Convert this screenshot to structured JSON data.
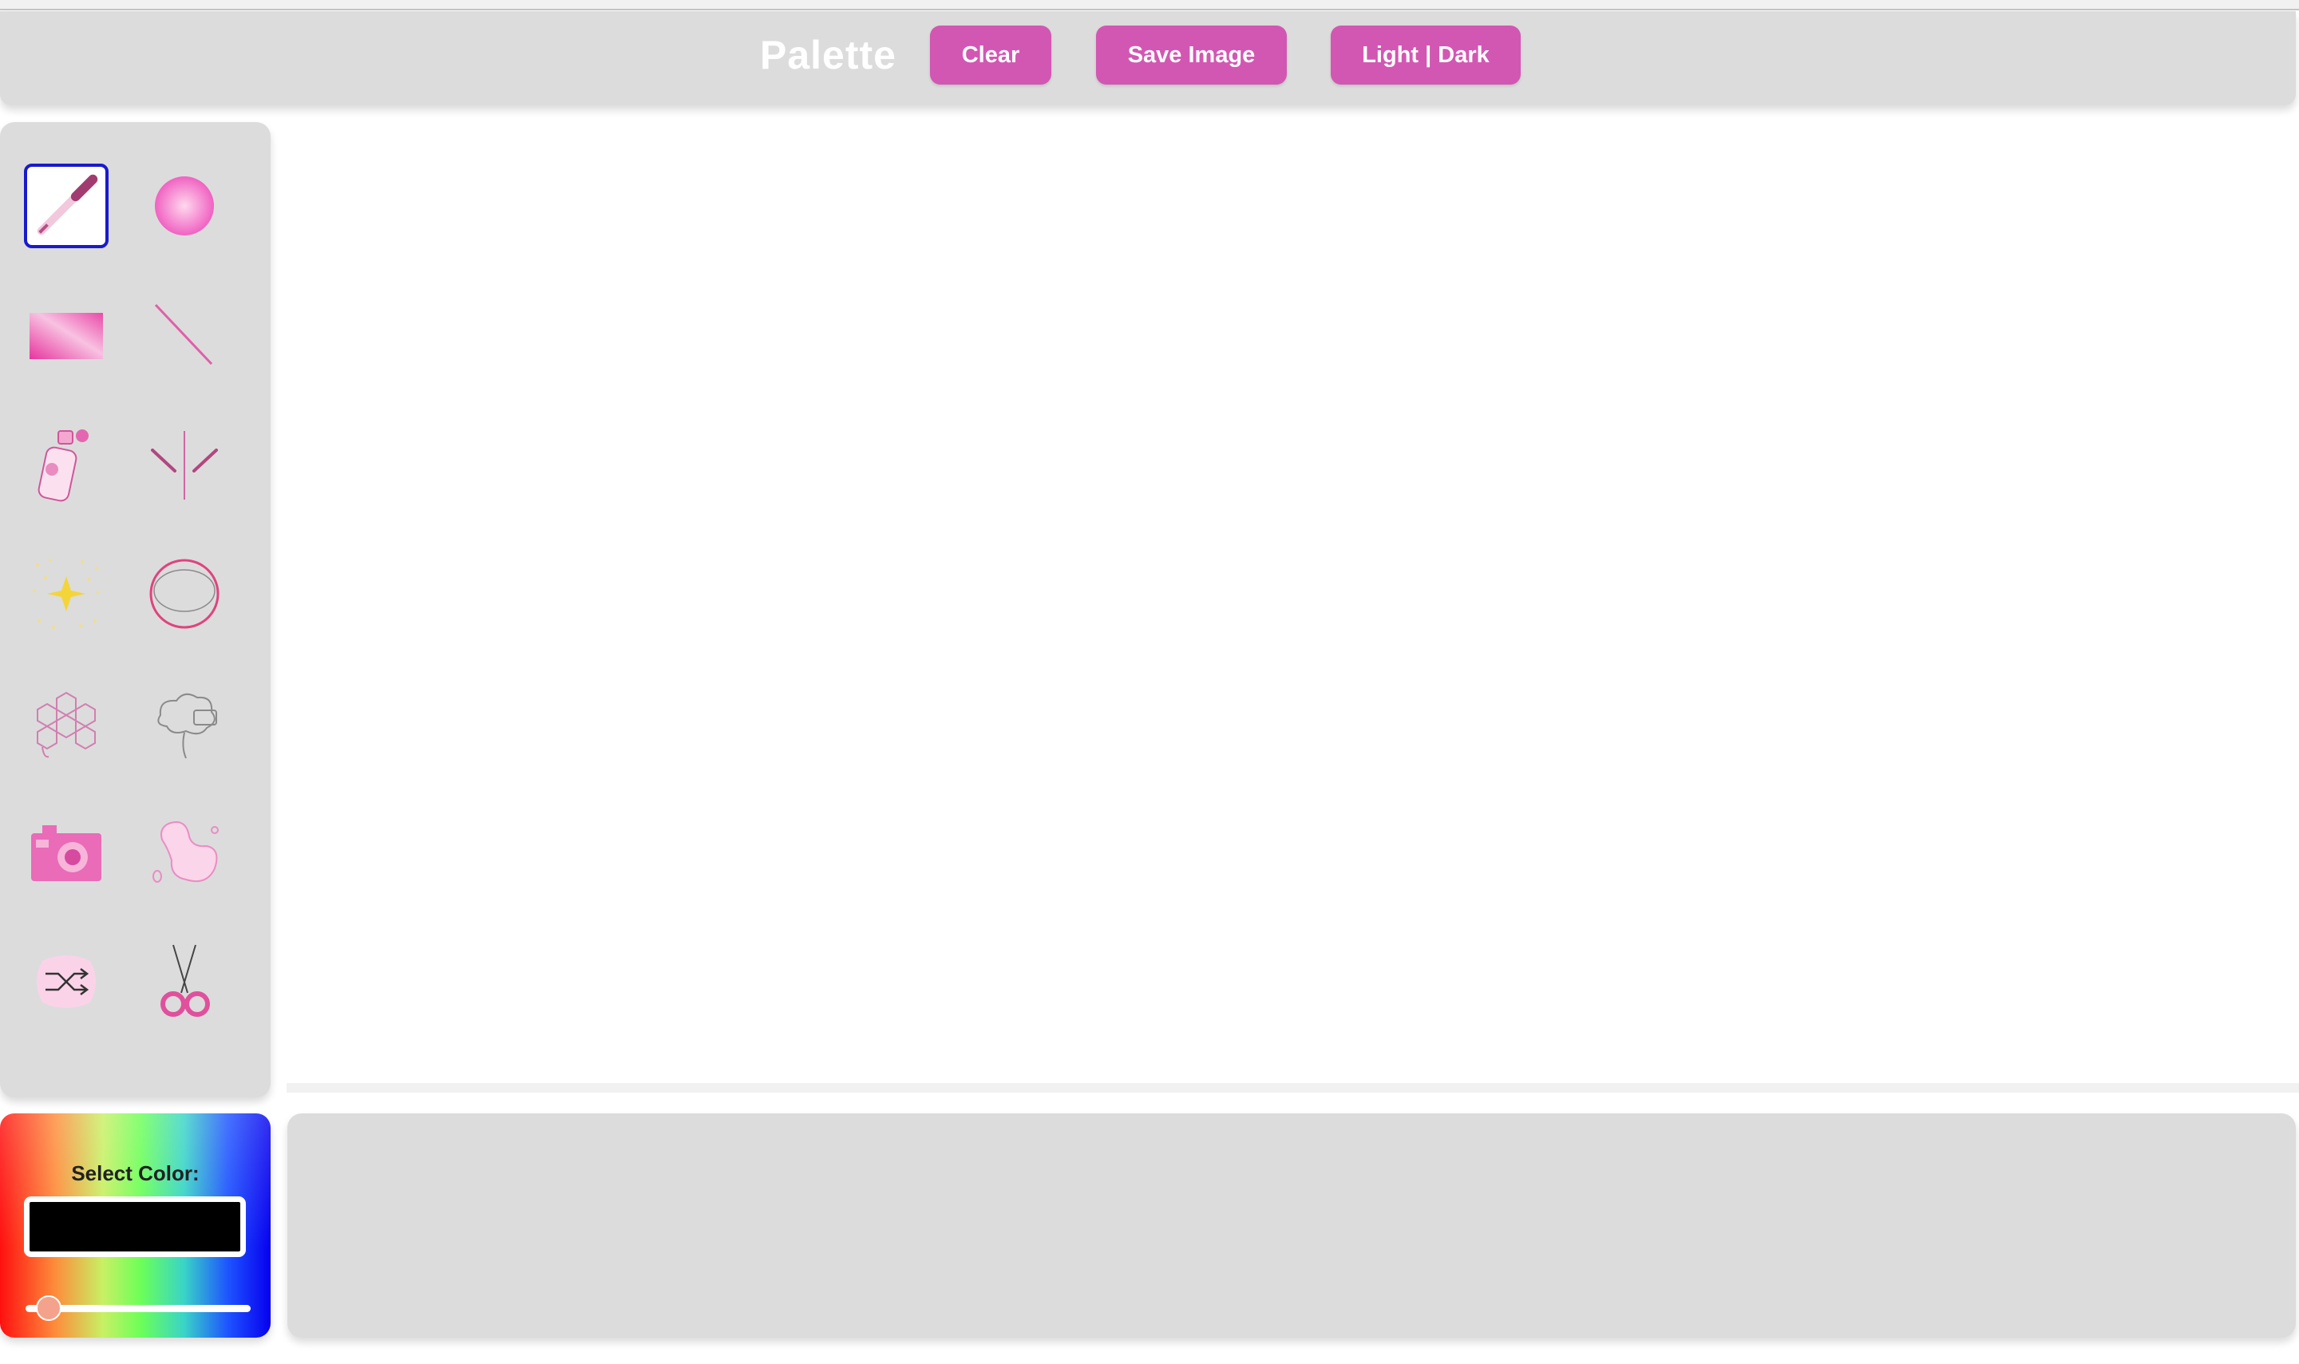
{
  "header": {
    "app_title": "Palette",
    "clear_label": "Clear",
    "save_label": "Save Image",
    "theme_label": "Light | Dark"
  },
  "toolbar": {
    "selected_tool": "pencil",
    "tools": [
      {
        "id": "pencil",
        "icon": "pencil-icon"
      },
      {
        "id": "circle-brush",
        "icon": "circle-brush-icon"
      },
      {
        "id": "rectangle",
        "icon": "rectangle-icon"
      },
      {
        "id": "line",
        "icon": "line-icon"
      },
      {
        "id": "spray",
        "icon": "spray-can-icon"
      },
      {
        "id": "mirror",
        "icon": "mirror-icon"
      },
      {
        "id": "sparkle",
        "icon": "sparkle-icon"
      },
      {
        "id": "ellipse",
        "icon": "ellipse-icon"
      },
      {
        "id": "honeycomb",
        "icon": "honeycomb-icon"
      },
      {
        "id": "cloud",
        "icon": "cloud-icon"
      },
      {
        "id": "camera",
        "icon": "camera-icon"
      },
      {
        "id": "blob",
        "icon": "blob-icon"
      },
      {
        "id": "shuffle",
        "icon": "shuffle-icon"
      },
      {
        "id": "scissors",
        "icon": "scissors-icon"
      }
    ]
  },
  "color": {
    "label": "Select Color:",
    "value": "#000000",
    "slider_fraction": 0.05
  },
  "colors": {
    "accent": "#d257b3",
    "panel": "#dcdcdc",
    "selected_border": "#1a1acc"
  }
}
